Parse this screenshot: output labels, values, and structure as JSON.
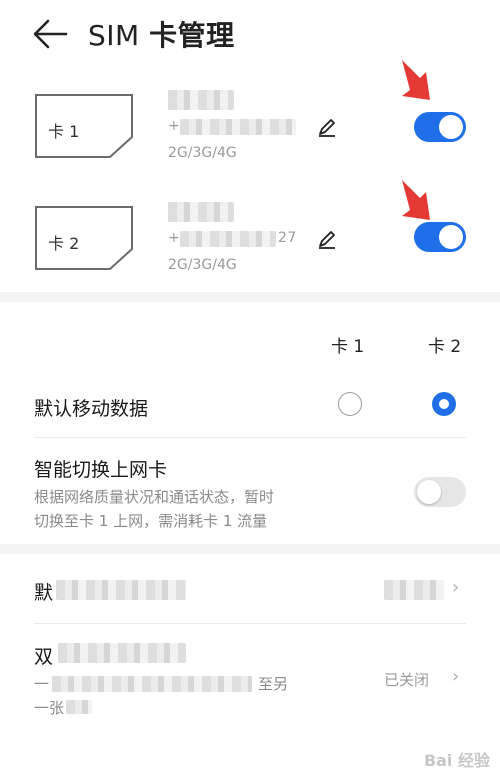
{
  "header": {
    "title_prefix": "SIM ",
    "title_bold": "卡管理"
  },
  "sim_cards": [
    {
      "label": "卡 1",
      "number": "+",
      "number_suffix": "",
      "network": "2G/3G/4G",
      "enabled": true
    },
    {
      "label": "卡 2",
      "number": "+",
      "number_suffix": "27",
      "network": "2G/3G/4G",
      "enabled": true
    }
  ],
  "columns": {
    "card1": "卡 1",
    "card2": "卡 2"
  },
  "default_data": {
    "title": "默认移动数据",
    "selected": "card2"
  },
  "smart_switch": {
    "title": "智能切换上网卡",
    "description_line1": "根据网络质量状况和通话状态，暂时",
    "description_line2": "切换至卡 1 上网，需消耗卡 1 流量",
    "enabled": false
  },
  "row_default": {
    "title_visible": "默"
  },
  "row_dual": {
    "title_visible": "双",
    "desc_line1_visible": "一",
    "desc_line1_tail": "至另",
    "desc_line2_visible": "一张",
    "value_visible": "已关闭"
  },
  "watermark": "Bai 经验",
  "colors": {
    "accent": "#1e6fe8",
    "arrow": "#e53935",
    "toggle_off": "#e6e6e6"
  }
}
